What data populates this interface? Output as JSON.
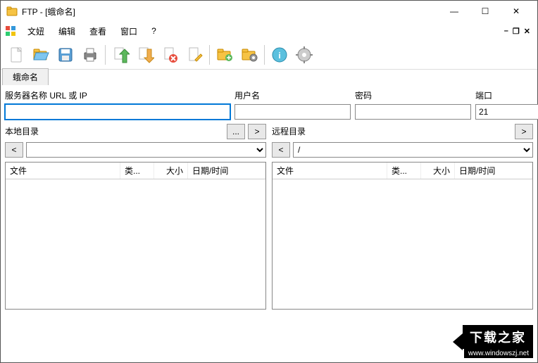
{
  "window": {
    "title": "FTP - [蛾命名]"
  },
  "menu": {
    "file": "文妞",
    "edit": "编辑",
    "view": "查看",
    "window": "窗口",
    "help": "?"
  },
  "tab": {
    "label": "蛾命名"
  },
  "labels": {
    "server": "服务器名称 URL 或 IP",
    "user": "用户名",
    "pass": "密码",
    "port": "端口",
    "localDir": "本地目录",
    "remoteDir": "远程目录"
  },
  "fields": {
    "server": "",
    "user": "",
    "pass": "",
    "port": "21",
    "localPath": "",
    "remotePath": "/"
  },
  "buttons": {
    "dots": "...",
    "go": ">",
    "close": "X",
    "back": "<"
  },
  "columns": {
    "file": "文件",
    "type": "类...",
    "size": "大小",
    "date": "日期/时间"
  },
  "winControls": {
    "min": "—",
    "max": "☐",
    "close": "✕"
  },
  "subControls": {
    "min": "–",
    "restore": "❐",
    "close": "✕"
  },
  "watermark": {
    "text": "下载之家",
    "url": "www.windowszj.net"
  }
}
